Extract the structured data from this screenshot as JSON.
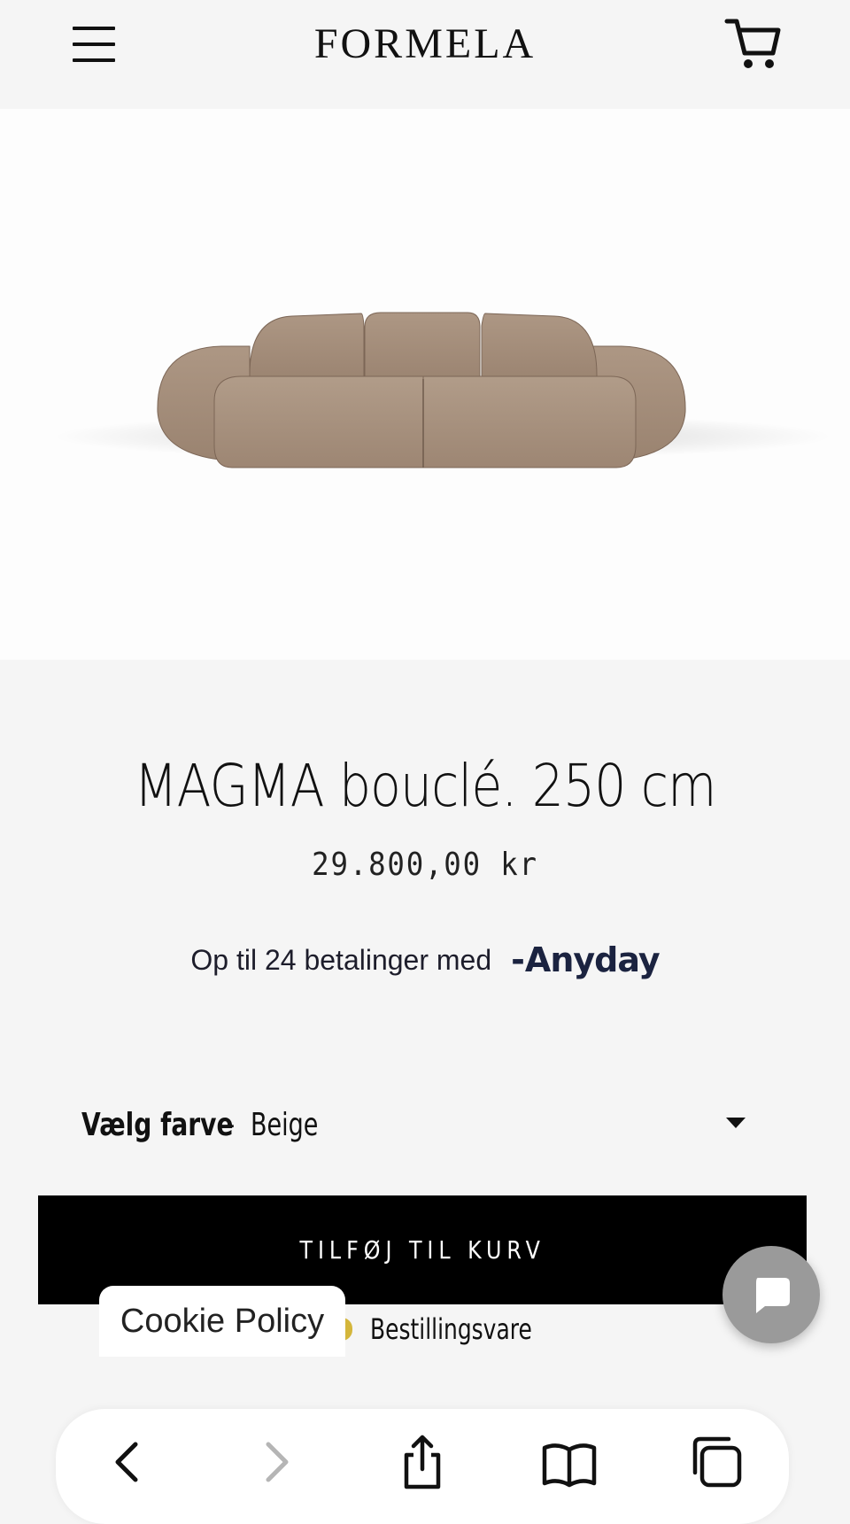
{
  "header": {
    "brand": "FORMELA"
  },
  "product": {
    "title": "MAGMA bouclé. 250 cm",
    "price": "29.800,00 kr",
    "installments_text": "Op til 24 betalinger med",
    "installments_brand": "Anyday",
    "color_label": "Vælg farve",
    "color_separator": "-",
    "color_value": "Beige",
    "add_to_cart": "TILFØJ TIL KURV",
    "stock_status": "Bestillingsvare",
    "fabric_color": "#a28b78",
    "stock_dot_color": "#d4b63b"
  },
  "cookie": {
    "label": "Cookie Policy"
  },
  "icons": {
    "menu": "hamburger-icon",
    "cart": "cart-icon",
    "chat": "chat-icon",
    "back": "chevron-left-icon",
    "forward": "chevron-right-icon",
    "share": "share-icon",
    "bookmarks": "book-icon",
    "tabs": "tabs-icon"
  }
}
